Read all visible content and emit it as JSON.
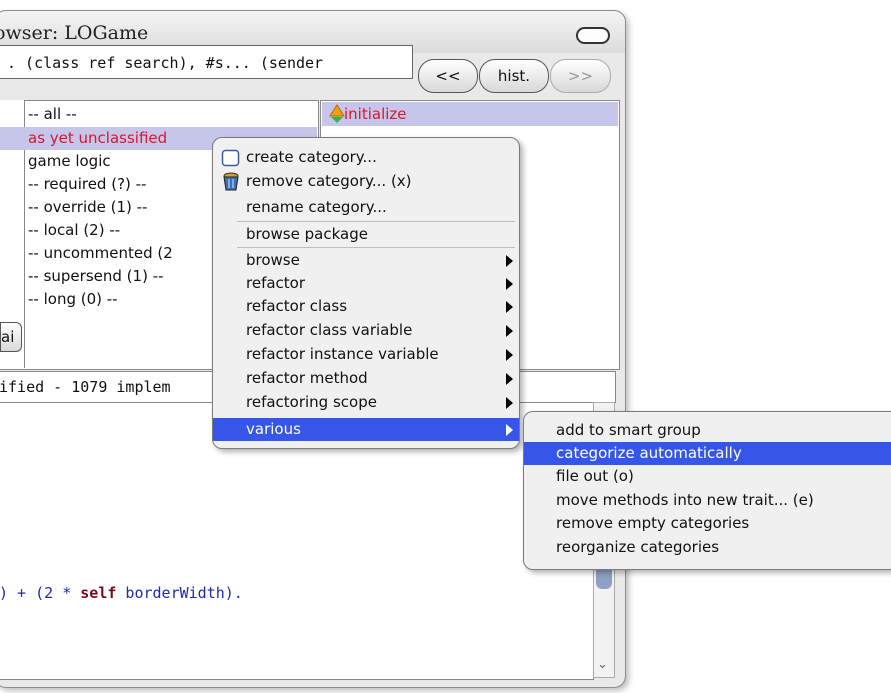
{
  "window": {
    "title": "rowser: LOGame"
  },
  "toolbar": {
    "search_text": ". (class ref search), #s... (sender",
    "back_label": "<<",
    "history_label": "hist.",
    "forward_label": ">>"
  },
  "categories": {
    "items": [
      "-- all --",
      "as yet unclassified",
      "game logic",
      "-- required (?) --",
      "-- override (1) --",
      "-- local (2) --",
      "-- uncommented (2",
      "-- supersend (1) --",
      "-- long (0) --"
    ],
    "selected": "as yet unclassified",
    "button_fragment": "ai"
  },
  "methods": {
    "items": [
      "initialize"
    ]
  },
  "status_bar": {
    "text": "ified - 1079 implem"
  },
  "code": {
    "before": ") + (2 * ",
    "keyword": "self",
    "after": " borderWidth)."
  },
  "context_menu": {
    "items": [
      {
        "label": "create category...",
        "icon": "blank-page-icon"
      },
      {
        "label": "remove category... (x)",
        "icon": "trash-can-icon"
      },
      {
        "label": "rename category..."
      },
      {
        "label": "browse package"
      },
      {
        "label": "browse",
        "submenu": true
      },
      {
        "label": "refactor",
        "submenu": true
      },
      {
        "label": "refactor class",
        "submenu": true
      },
      {
        "label": "refactor class variable",
        "submenu": true
      },
      {
        "label": "refactor instance variable",
        "submenu": true
      },
      {
        "label": "refactor method",
        "submenu": true
      },
      {
        "label": "refactoring scope",
        "submenu": true
      },
      {
        "label": "various",
        "submenu": true,
        "selected": true
      }
    ]
  },
  "submenu": {
    "items": [
      "add to smart group",
      "categorize automatically",
      "file out (o)",
      "move methods into new trait... (e)",
      "remove empty categories",
      "reorganize categories"
    ],
    "selected": "categorize automatically"
  },
  "colors": {
    "selection_blue": "#3556e8",
    "list_selection": "#c5c6ea",
    "highlight_red": "#e0132b"
  }
}
